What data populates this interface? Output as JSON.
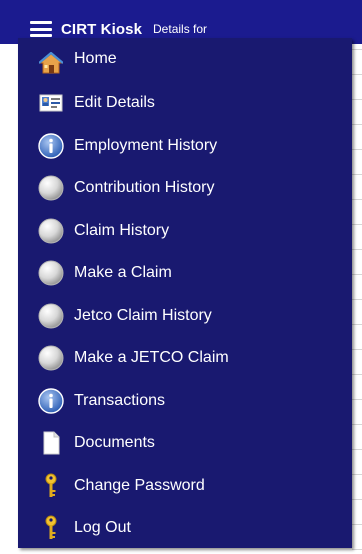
{
  "header": {
    "title": "CIRT Kiosk",
    "subtitle": "Details for",
    "menu_icon": "hamburger-icon"
  },
  "menu": {
    "items": [
      {
        "label": "Home",
        "icon": "home-icon"
      },
      {
        "label": "Edit Details",
        "icon": "id-card-icon"
      },
      {
        "label": "Employment History",
        "icon": "info-icon"
      },
      {
        "label": "Contribution History",
        "icon": "coin-icon"
      },
      {
        "label": "Claim History",
        "icon": "coin-icon"
      },
      {
        "label": "Make a Claim",
        "icon": "coin-icon"
      },
      {
        "label": "Jetco Claim History",
        "icon": "coin-icon"
      },
      {
        "label": "Make a JETCO Claim",
        "icon": "coin-icon"
      },
      {
        "label": "Transactions",
        "icon": "info-icon"
      },
      {
        "label": "Documents",
        "icon": "document-icon"
      },
      {
        "label": "Change Password",
        "icon": "key-icon"
      },
      {
        "label": "Log Out",
        "icon": "key-icon"
      }
    ]
  },
  "colors": {
    "header_bg": "#1b1b8f",
    "menu_bg": "#191970",
    "text": "#ffffff"
  }
}
